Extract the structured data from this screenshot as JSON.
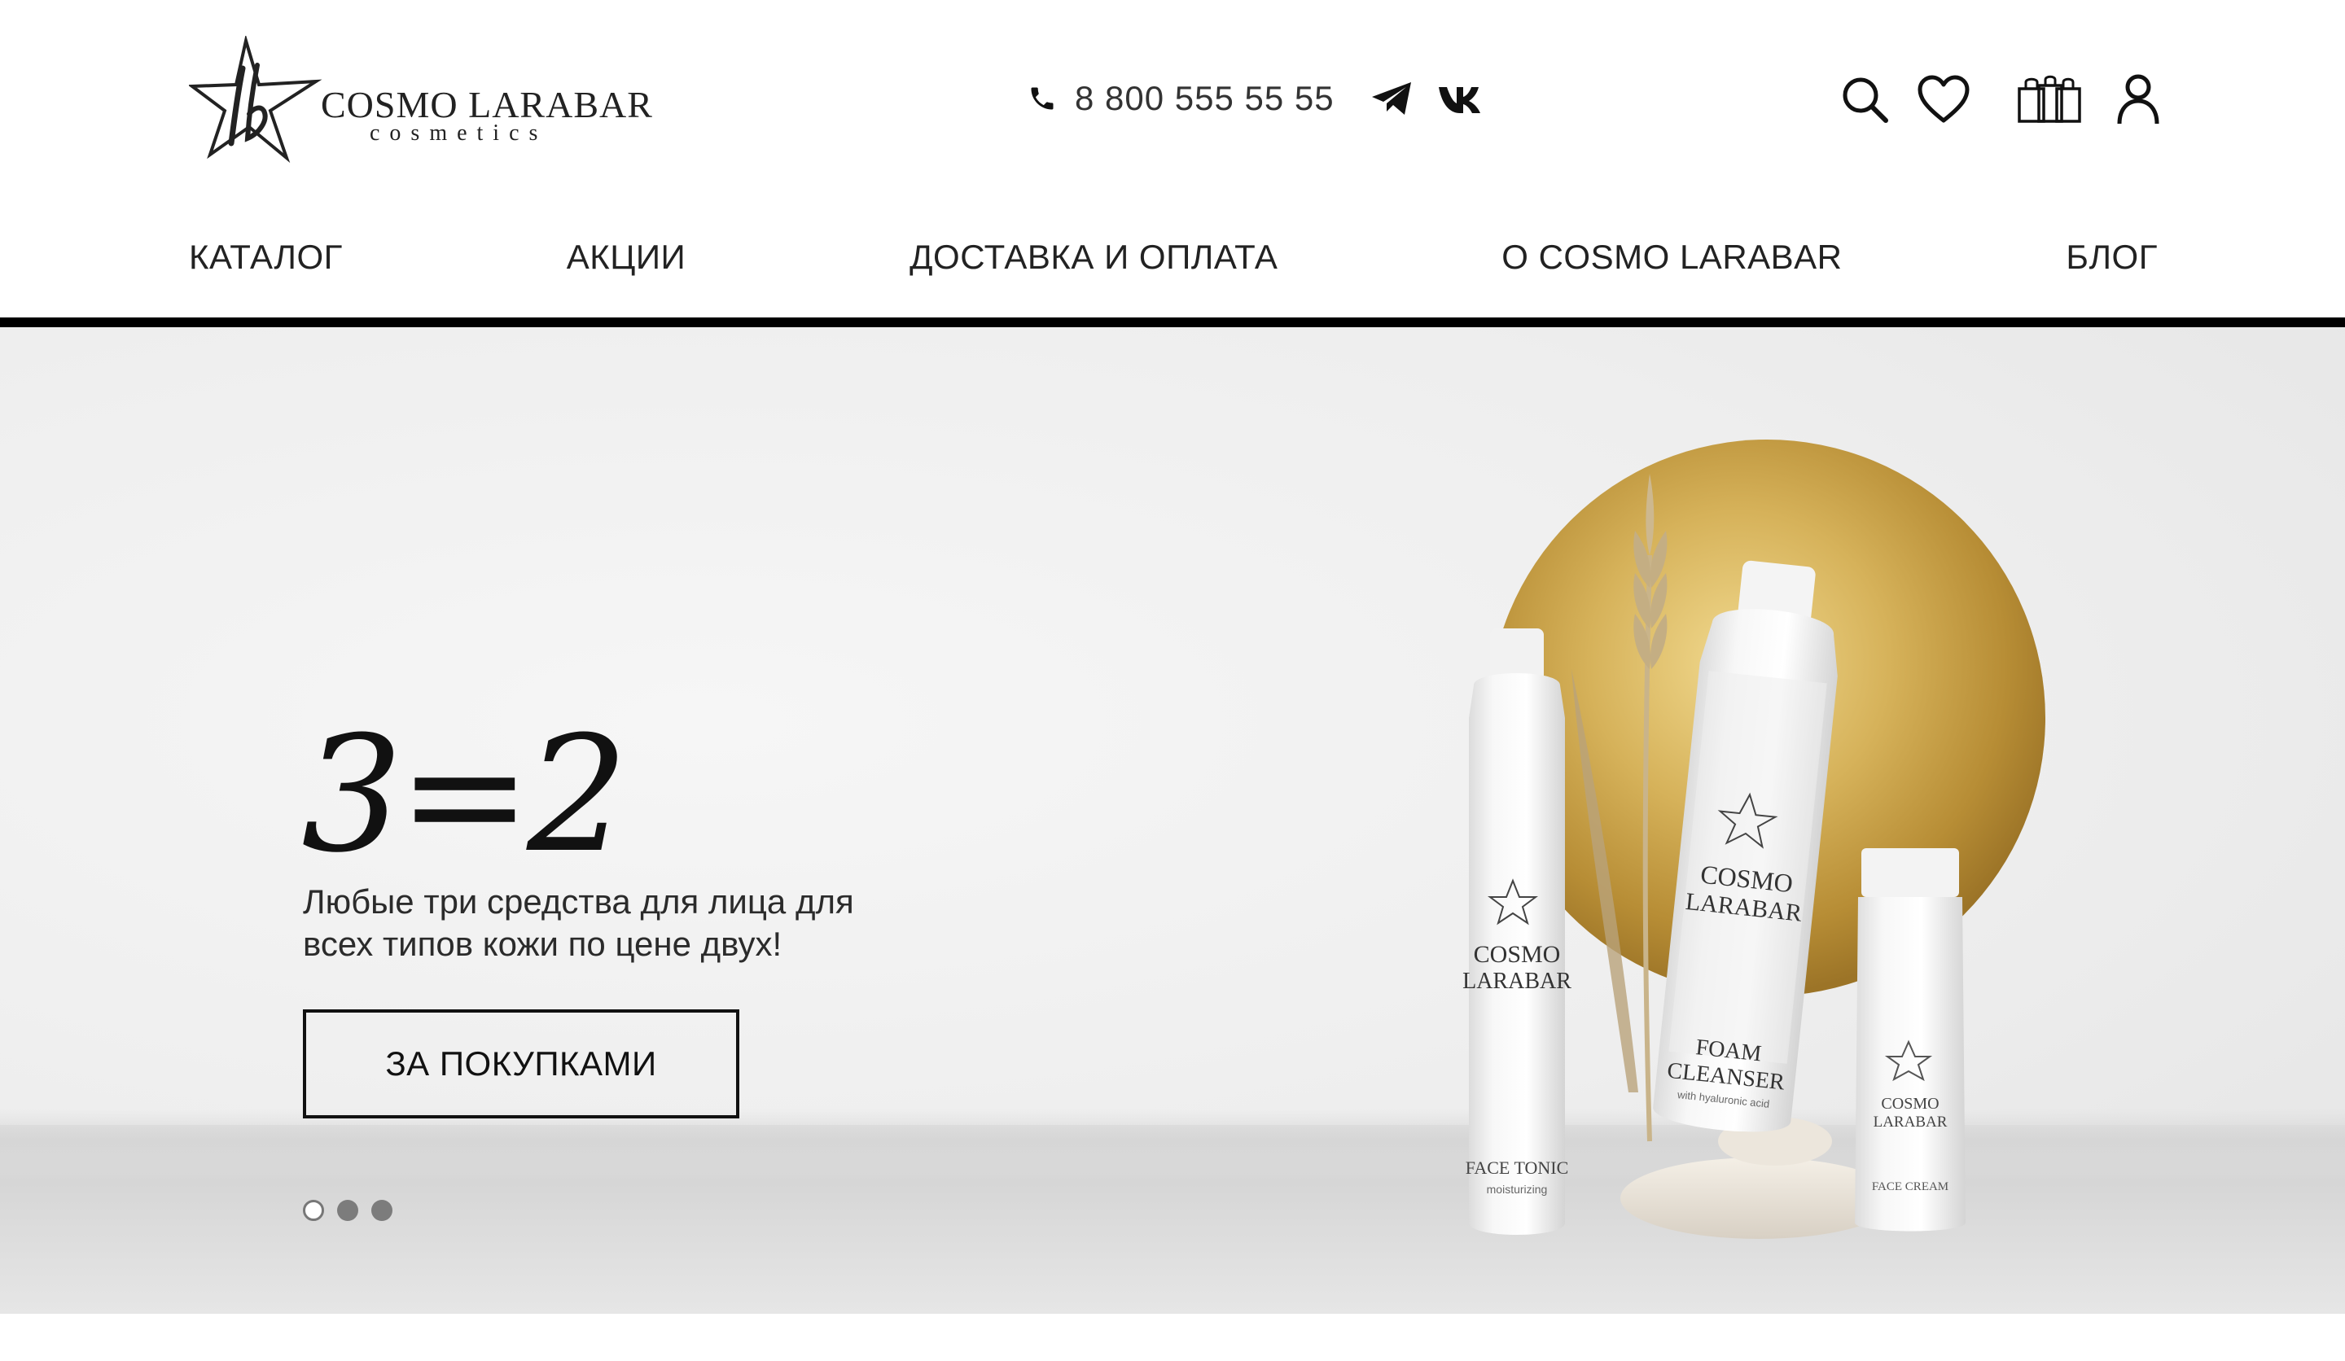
{
  "brand": {
    "name": "COSMO LARABAR",
    "tagline": "cosmetics"
  },
  "contacts": {
    "phone": "8 800 555 55 55",
    "social": [
      "telegram-icon",
      "vk-icon"
    ]
  },
  "header_actions": [
    "search-icon",
    "heart-icon",
    "shopping-bags-icon",
    "user-icon"
  ],
  "nav": {
    "items": [
      {
        "label": "КАТАЛОГ"
      },
      {
        "label": "АКЦИИ"
      },
      {
        "label": "ДОСТАВКА И ОПЛАТА"
      },
      {
        "label": "О COSMO LARABAR"
      },
      {
        "label": "БЛОГ"
      }
    ]
  },
  "hero": {
    "title": "3=2",
    "text": "Любые три средства для лица для всех типов кожи по цене двух!",
    "cta_label": "ЗА ПОКУПКАМИ",
    "slides_total": 3,
    "active_slide": 1,
    "products": {
      "bottle_left": {
        "brand_line1": "COSMO",
        "brand_line2": "LARABAR",
        "name": "FACE TONIC",
        "sub": "moisturizing"
      },
      "bottle_center": {
        "brand_line1": "COSMO",
        "brand_line2": "LARABAR",
        "name_line1": "FOAM",
        "name_line2": "CLEANSER",
        "sub": "with hyaluronic acid"
      },
      "bottle_right": {
        "brand_line1": "COSMO",
        "brand_line2": "LARABAR",
        "name": "FACE CREAM"
      }
    }
  },
  "colors": {
    "text": "#1a1a1a",
    "rule": "#000000",
    "gold": "#c9a24a",
    "hero_bg": "#eeeeee"
  }
}
